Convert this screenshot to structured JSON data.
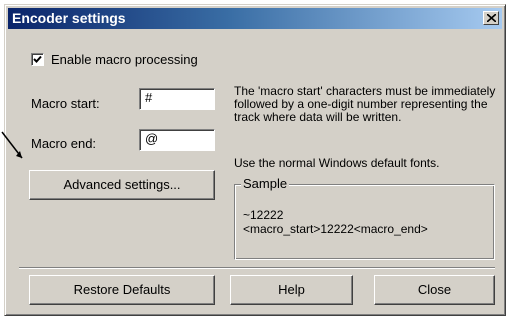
{
  "window": {
    "title": "Encoder settings",
    "close_icon": "close-x-icon"
  },
  "macro": {
    "enable_label": "Enable macro processing",
    "enabled": true,
    "start_label": "Macro start:",
    "start_value": "#",
    "end_label": "Macro end:",
    "end_value": "@"
  },
  "description": "The 'macro start' characters must be immediately followed by a one-digit number representing the track where data will be written.",
  "font_note": "Use the normal Windows default fonts.",
  "sample": {
    "legend": "Sample",
    "line1": "~12222",
    "line2": "<macro_start>12222<macro_end>"
  },
  "buttons": {
    "advanced": "Advanced settings...",
    "restore": "Restore Defaults",
    "help": "Help",
    "close": "Close"
  },
  "colors": {
    "title_start": "#0a246a",
    "title_end": "#a6caf0",
    "face": "#d4d0c8"
  }
}
